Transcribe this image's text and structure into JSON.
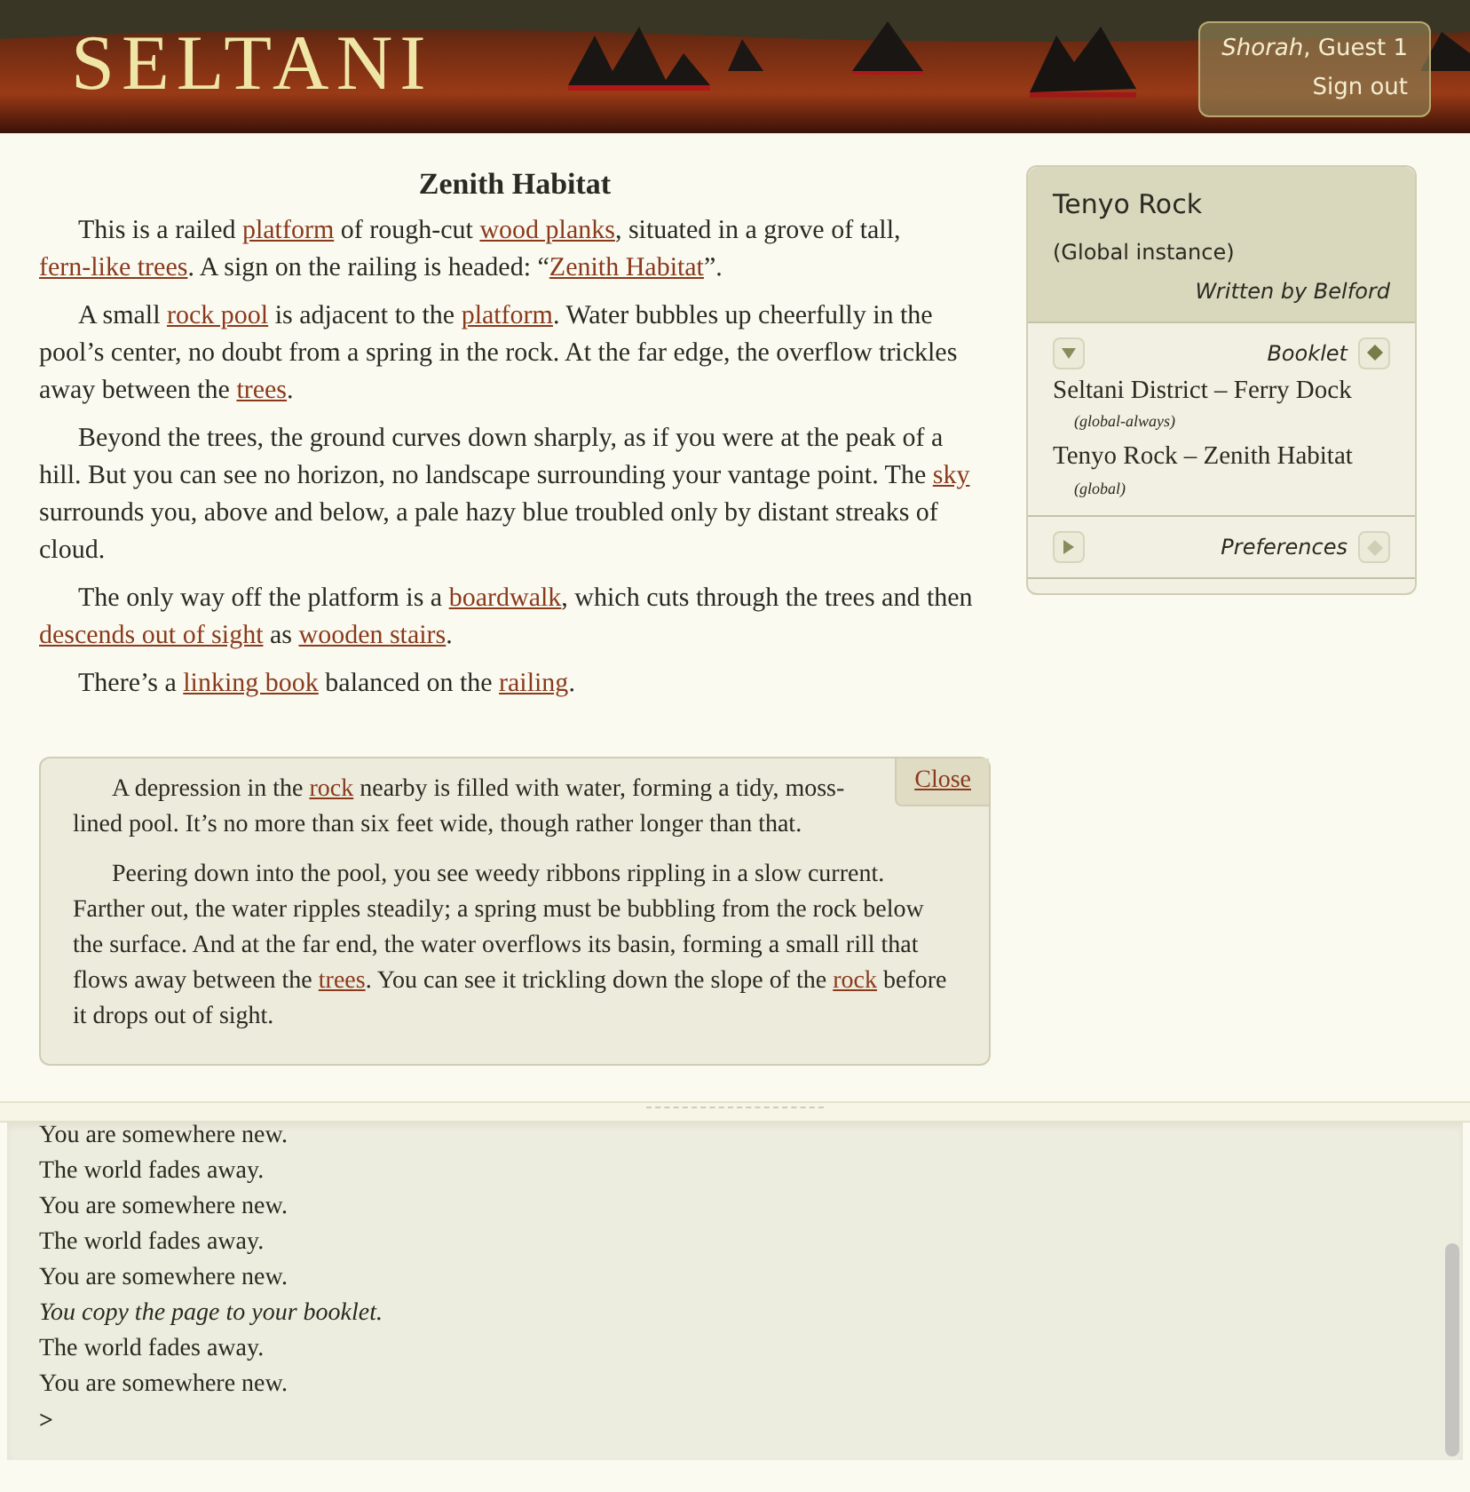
{
  "header": {
    "logo": "SELTANI",
    "user": {
      "name": "Shorah",
      "role": ", Guest 1"
    },
    "signout": "Sign out"
  },
  "room": {
    "title": "Zenith Habitat",
    "paragraphs": [
      [
        {
          "kind": "text",
          "text": "This is a railed "
        },
        {
          "kind": "link",
          "text": "platform"
        },
        {
          "kind": "text",
          "text": " of rough-cut "
        },
        {
          "kind": "link",
          "text": "wood planks"
        },
        {
          "kind": "text",
          "text": ", situated in a grove of tall, "
        },
        {
          "kind": "link",
          "text": "fern-like trees"
        },
        {
          "kind": "text",
          "text": ". A sign on the railing is headed: “"
        },
        {
          "kind": "link",
          "text": "Zenith Habitat"
        },
        {
          "kind": "text",
          "text": "”."
        }
      ],
      [
        {
          "kind": "text",
          "text": "A small "
        },
        {
          "kind": "link",
          "text": "rock pool"
        },
        {
          "kind": "text",
          "text": " is adjacent to the "
        },
        {
          "kind": "link",
          "text": "platform"
        },
        {
          "kind": "text",
          "text": ". Water bubbles up cheerfully in the pool’s center, no doubt from a spring in the rock. At the far edge, the overflow trickles away between the "
        },
        {
          "kind": "link",
          "text": "trees"
        },
        {
          "kind": "text",
          "text": "."
        }
      ],
      [
        {
          "kind": "text",
          "text": "Beyond the trees, the ground curves down sharply, as if you were at the peak of a hill. But you can see no horizon, no landscape surrounding your vantage point. The "
        },
        {
          "kind": "link",
          "text": "sky"
        },
        {
          "kind": "text",
          "text": " surrounds you, above and below, a pale hazy blue troubled only by distant streaks of cloud."
        }
      ],
      [
        {
          "kind": "text",
          "text": "The only way off the platform is a "
        },
        {
          "kind": "link",
          "text": "boardwalk"
        },
        {
          "kind": "text",
          "text": ", which cuts through the trees and then "
        },
        {
          "kind": "link",
          "text": "descends out of sight"
        },
        {
          "kind": "text",
          "text": " as "
        },
        {
          "kind": "link",
          "text": "wooden stairs"
        },
        {
          "kind": "text",
          "text": "."
        }
      ],
      [
        {
          "kind": "text",
          "text": "There’s a "
        },
        {
          "kind": "link",
          "text": "linking book"
        },
        {
          "kind": "text",
          "text": " balanced on the "
        },
        {
          "kind": "link",
          "text": "railing"
        },
        {
          "kind": "text",
          "text": "."
        }
      ]
    ]
  },
  "popup": {
    "close": "Close",
    "paragraphs": [
      [
        {
          "kind": "text",
          "text": "A depression in the "
        },
        {
          "kind": "link",
          "text": "rock"
        },
        {
          "kind": "text",
          "text": " nearby is filled with water, forming a tidy, moss-lined pool. It’s no more than six feet wide, though rather longer than that."
        }
      ],
      [
        {
          "kind": "text",
          "text": "Peering down into the pool, you see weedy ribbons rippling in a slow current. Farther out, the water ripples steadily; a spring must be bubbling from the rock below the surface. And at the far end, the water overflows its basin, forming a small rill that flows away between the "
        },
        {
          "kind": "link",
          "text": "trees"
        },
        {
          "kind": "text",
          "text": ". You can see it trickling down the slope of the "
        },
        {
          "kind": "link",
          "text": "rock"
        },
        {
          "kind": "text",
          "text": " before it drops out of sight."
        }
      ]
    ]
  },
  "sidebar": {
    "title": "Tenyo Rock",
    "subtitle": "(Global instance)",
    "author": "Written by Belford",
    "booklet": {
      "label": "Booklet",
      "expanded": true,
      "entries": [
        {
          "name": "Seltani District – Ferry Dock",
          "scope": "(global-always)"
        },
        {
          "name": "Tenyo Rock – Zenith Habitat",
          "scope": "(global)"
        }
      ]
    },
    "preferences": {
      "label": "Preferences",
      "expanded": false
    }
  },
  "log": {
    "lines": [
      {
        "kind": "plain",
        "text": "You are somewhere new."
      },
      {
        "kind": "plain",
        "text": "The world fades away."
      },
      {
        "kind": "plain",
        "text": "You are somewhere new."
      },
      {
        "kind": "plain",
        "text": "The world fades away."
      },
      {
        "kind": "plain",
        "text": "You are somewhere new."
      },
      {
        "kind": "italic",
        "text": "You copy the page to your booklet."
      },
      {
        "kind": "plain",
        "text": "The world fades away."
      },
      {
        "kind": "plain",
        "text": "You are somewhere new."
      }
    ],
    "prompt": ">"
  }
}
